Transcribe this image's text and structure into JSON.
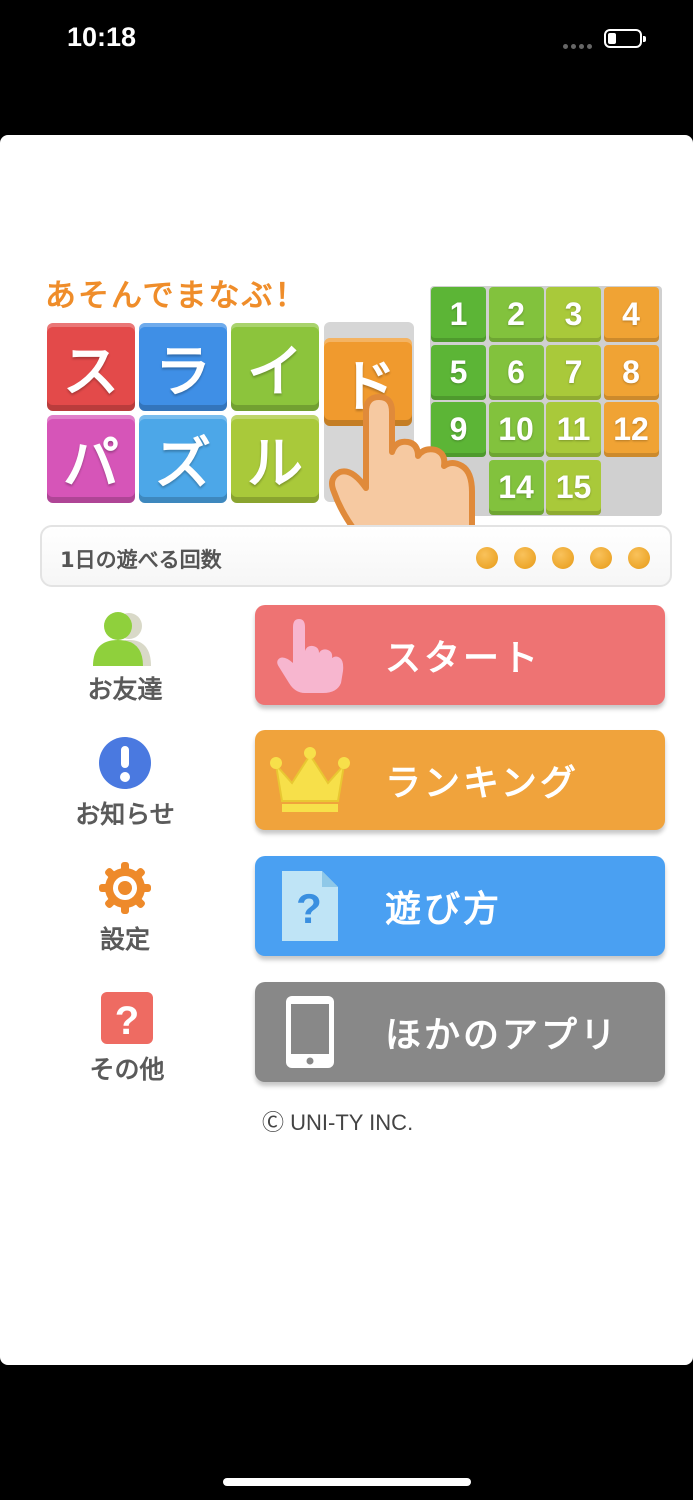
{
  "status_bar": {
    "time": "10:18"
  },
  "logo": {
    "subtitle": "あそんでまなぶ！",
    "title_chars": [
      "ス",
      "ラ",
      "イ",
      "ド",
      "パ",
      "ズ",
      "ル"
    ],
    "tile_colors": [
      "#e34a4a",
      "#3f8fe6",
      "#8cc43c",
      "#f09a2e",
      "#d655b8",
      "#4ca7e8",
      "#a9c93a"
    ],
    "grid_numbers": [
      "1",
      "2",
      "3",
      "4",
      "5",
      "6",
      "7",
      "8",
      "9",
      "10",
      "11",
      "12",
      "14",
      "15"
    ]
  },
  "plays": {
    "label": "1日の遊べる回数",
    "remaining": 5
  },
  "side_menu": [
    {
      "label": "お友達",
      "icon": "friends-icon"
    },
    {
      "label": "お知らせ",
      "icon": "info-icon"
    },
    {
      "label": "設定",
      "icon": "gear-icon"
    },
    {
      "label": "その他",
      "icon": "question-icon"
    }
  ],
  "buttons": [
    {
      "label": "スタート",
      "icon": "pointing-hand-icon",
      "color": "#ee7373"
    },
    {
      "label": "ランキング",
      "icon": "crown-icon",
      "color": "#f0a33c"
    },
    {
      "label": "遊び方",
      "icon": "help-document-icon",
      "color": "#4aa0f2"
    },
    {
      "label": "ほかのアプリ",
      "icon": "smartphone-icon",
      "color": "#888888"
    }
  ],
  "copyright": "UNI-TY INC.",
  "copyright_symbol": "Ⓒ"
}
